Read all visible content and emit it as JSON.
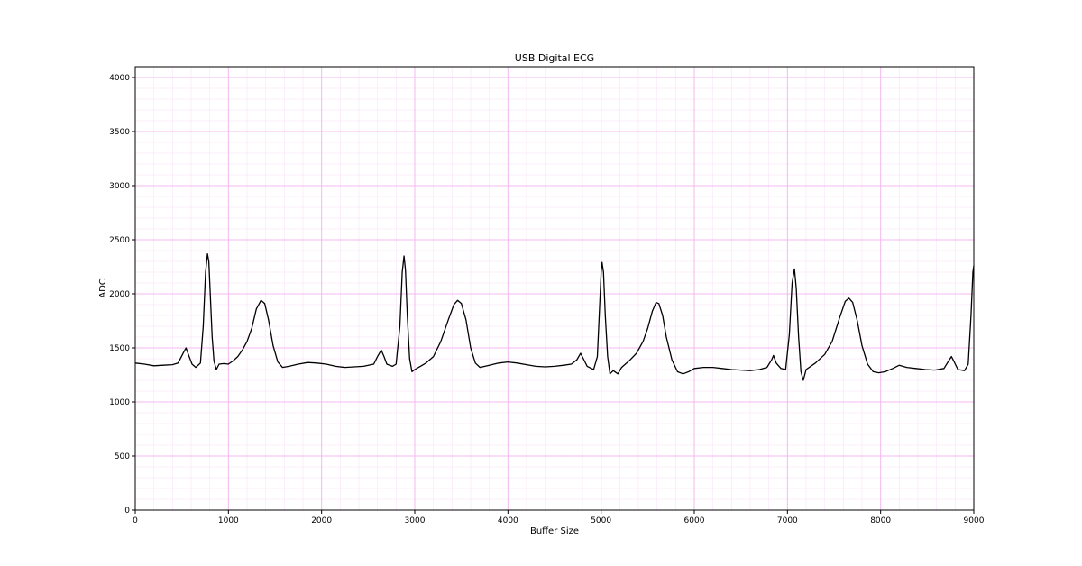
{
  "chart_data": {
    "type": "line",
    "title": "USB Digital ECG",
    "xlabel": "Buffer Size",
    "ylabel": "ADC",
    "xlim": [
      0,
      9000
    ],
    "ylim": [
      0,
      4100
    ],
    "xticks": [
      0,
      1000,
      2000,
      3000,
      4000,
      5000,
      6000,
      7000,
      8000,
      9000
    ],
    "yticks": [
      0,
      500,
      1000,
      1500,
      2000,
      2500,
      3000,
      3500,
      4000
    ],
    "grid": true,
    "colors": {
      "line": "#000000",
      "major_grid": "#f4b8f0",
      "minor_grid": "#fbe6fa",
      "axes": "#000000"
    },
    "series": [
      {
        "points": [
          [
            0,
            1360
          ],
          [
            100,
            1350
          ],
          [
            200,
            1335
          ],
          [
            300,
            1340
          ],
          [
            400,
            1345
          ],
          [
            460,
            1360
          ],
          [
            520,
            1460
          ],
          [
            545,
            1500
          ],
          [
            570,
            1440
          ],
          [
            610,
            1350
          ],
          [
            650,
            1320
          ],
          [
            700,
            1360
          ],
          [
            730,
            1700
          ],
          [
            755,
            2200
          ],
          [
            775,
            2370
          ],
          [
            790,
            2300
          ],
          [
            805,
            2000
          ],
          [
            825,
            1600
          ],
          [
            845,
            1380
          ],
          [
            870,
            1300
          ],
          [
            900,
            1350
          ],
          [
            950,
            1355
          ],
          [
            1000,
            1350
          ],
          [
            1050,
            1380
          ],
          [
            1100,
            1420
          ],
          [
            1150,
            1480
          ],
          [
            1200,
            1560
          ],
          [
            1250,
            1680
          ],
          [
            1300,
            1860
          ],
          [
            1350,
            1940
          ],
          [
            1390,
            1910
          ],
          [
            1430,
            1760
          ],
          [
            1480,
            1520
          ],
          [
            1530,
            1370
          ],
          [
            1580,
            1320
          ],
          [
            1650,
            1330
          ],
          [
            1750,
            1350
          ],
          [
            1850,
            1365
          ],
          [
            1950,
            1360
          ],
          [
            2050,
            1350
          ],
          [
            2150,
            1330
          ],
          [
            2250,
            1320
          ],
          [
            2350,
            1325
          ],
          [
            2450,
            1330
          ],
          [
            2560,
            1350
          ],
          [
            2600,
            1420
          ],
          [
            2640,
            1480
          ],
          [
            2670,
            1420
          ],
          [
            2700,
            1350
          ],
          [
            2760,
            1330
          ],
          [
            2800,
            1350
          ],
          [
            2840,
            1700
          ],
          [
            2865,
            2200
          ],
          [
            2885,
            2350
          ],
          [
            2900,
            2220
          ],
          [
            2920,
            1800
          ],
          [
            2945,
            1400
          ],
          [
            2970,
            1280
          ],
          [
            3000,
            1300
          ],
          [
            3060,
            1330
          ],
          [
            3120,
            1360
          ],
          [
            3200,
            1420
          ],
          [
            3280,
            1560
          ],
          [
            3360,
            1760
          ],
          [
            3420,
            1900
          ],
          [
            3460,
            1940
          ],
          [
            3500,
            1910
          ],
          [
            3550,
            1760
          ],
          [
            3600,
            1500
          ],
          [
            3650,
            1360
          ],
          [
            3700,
            1320
          ],
          [
            3800,
            1340
          ],
          [
            3900,
            1360
          ],
          [
            4000,
            1370
          ],
          [
            4100,
            1360
          ],
          [
            4200,
            1345
          ],
          [
            4300,
            1330
          ],
          [
            4400,
            1325
          ],
          [
            4500,
            1330
          ],
          [
            4600,
            1340
          ],
          [
            4680,
            1350
          ],
          [
            4740,
            1390
          ],
          [
            4780,
            1450
          ],
          [
            4810,
            1400
          ],
          [
            4850,
            1330
          ],
          [
            4920,
            1300
          ],
          [
            4960,
            1420
          ],
          [
            4985,
            1900
          ],
          [
            5000,
            2200
          ],
          [
            5010,
            2290
          ],
          [
            5025,
            2200
          ],
          [
            5045,
            1800
          ],
          [
            5070,
            1420
          ],
          [
            5095,
            1260
          ],
          [
            5130,
            1290
          ],
          [
            5180,
            1260
          ],
          [
            5220,
            1320
          ],
          [
            5300,
            1380
          ],
          [
            5380,
            1450
          ],
          [
            5450,
            1560
          ],
          [
            5500,
            1680
          ],
          [
            5550,
            1840
          ],
          [
            5590,
            1920
          ],
          [
            5620,
            1910
          ],
          [
            5660,
            1800
          ],
          [
            5700,
            1600
          ],
          [
            5760,
            1390
          ],
          [
            5820,
            1280
          ],
          [
            5880,
            1260
          ],
          [
            5940,
            1280
          ],
          [
            6000,
            1310
          ],
          [
            6100,
            1320
          ],
          [
            6200,
            1320
          ],
          [
            6300,
            1310
          ],
          [
            6400,
            1300
          ],
          [
            6500,
            1295
          ],
          [
            6600,
            1290
          ],
          [
            6700,
            1300
          ],
          [
            6780,
            1320
          ],
          [
            6830,
            1390
          ],
          [
            6850,
            1430
          ],
          [
            6880,
            1360
          ],
          [
            6930,
            1310
          ],
          [
            6980,
            1300
          ],
          [
            7020,
            1620
          ],
          [
            7050,
            2100
          ],
          [
            7075,
            2230
          ],
          [
            7095,
            2050
          ],
          [
            7120,
            1600
          ],
          [
            7145,
            1280
          ],
          [
            7170,
            1200
          ],
          [
            7200,
            1300
          ],
          [
            7300,
            1360
          ],
          [
            7400,
            1440
          ],
          [
            7480,
            1560
          ],
          [
            7560,
            1780
          ],
          [
            7620,
            1930
          ],
          [
            7660,
            1960
          ],
          [
            7700,
            1920
          ],
          [
            7750,
            1750
          ],
          [
            7800,
            1520
          ],
          [
            7860,
            1350
          ],
          [
            7920,
            1280
          ],
          [
            7980,
            1270
          ],
          [
            8050,
            1280
          ],
          [
            8130,
            1310
          ],
          [
            8200,
            1340
          ],
          [
            8280,
            1320
          ],
          [
            8380,
            1310
          ],
          [
            8480,
            1300
          ],
          [
            8580,
            1295
          ],
          [
            8680,
            1310
          ],
          [
            8730,
            1380
          ],
          [
            8760,
            1420
          ],
          [
            8790,
            1370
          ],
          [
            8830,
            1300
          ],
          [
            8900,
            1290
          ],
          [
            8940,
            1350
          ],
          [
            8970,
            1800
          ],
          [
            8990,
            2200
          ],
          [
            9000,
            2260
          ]
        ]
      }
    ]
  }
}
